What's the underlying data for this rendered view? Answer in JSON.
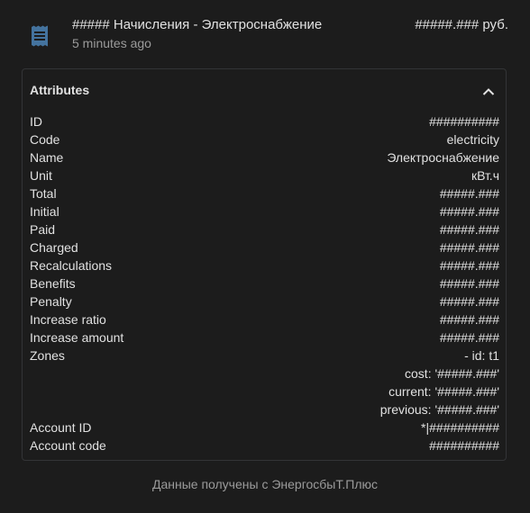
{
  "entity": {
    "icon": "receipt-icon",
    "name": "##### Начисления - Электроснабжение",
    "updated": "5 minutes ago",
    "state": "#####.### руб."
  },
  "attributes_panel": {
    "title": "Attributes",
    "collapse_icon": "chevron-up-icon",
    "rows": [
      {
        "key": "ID",
        "value": "##########"
      },
      {
        "key": "Code",
        "value": "electricity"
      },
      {
        "key": "Name",
        "value": "Электроснабжение"
      },
      {
        "key": "Unit",
        "value": "кВт.ч"
      },
      {
        "key": "Total",
        "value": "#####.###"
      },
      {
        "key": "Initial",
        "value": "#####.###"
      },
      {
        "key": "Paid",
        "value": "#####.###"
      },
      {
        "key": "Charged",
        "value": "#####.###"
      },
      {
        "key": "Recalculations",
        "value": "#####.###"
      },
      {
        "key": "Benefits",
        "value": "#####.###"
      },
      {
        "key": "Penalty",
        "value": "#####.###"
      },
      {
        "key": "Increase ratio",
        "value": "#####.###"
      },
      {
        "key": "Increase amount",
        "value": "#####.###"
      },
      {
        "key": "Zones",
        "value": "- id: t1"
      },
      {
        "key": "",
        "value": "cost: '#####.###'"
      },
      {
        "key": "",
        "value": "current: '#####.###'"
      },
      {
        "key": "",
        "value": "previous: '#####.###'"
      },
      {
        "key": "Account ID",
        "value": "*|##########"
      },
      {
        "key": "Account code",
        "value": "##########"
      }
    ]
  },
  "footer": {
    "attribution": "Данные получены с ЭнергосбыТ.Плюс"
  },
  "colors": {
    "background": "#1c1c1c",
    "icon": "#44739e",
    "text": "#e1e1e1",
    "secondary_text": "#9b9b9b"
  }
}
